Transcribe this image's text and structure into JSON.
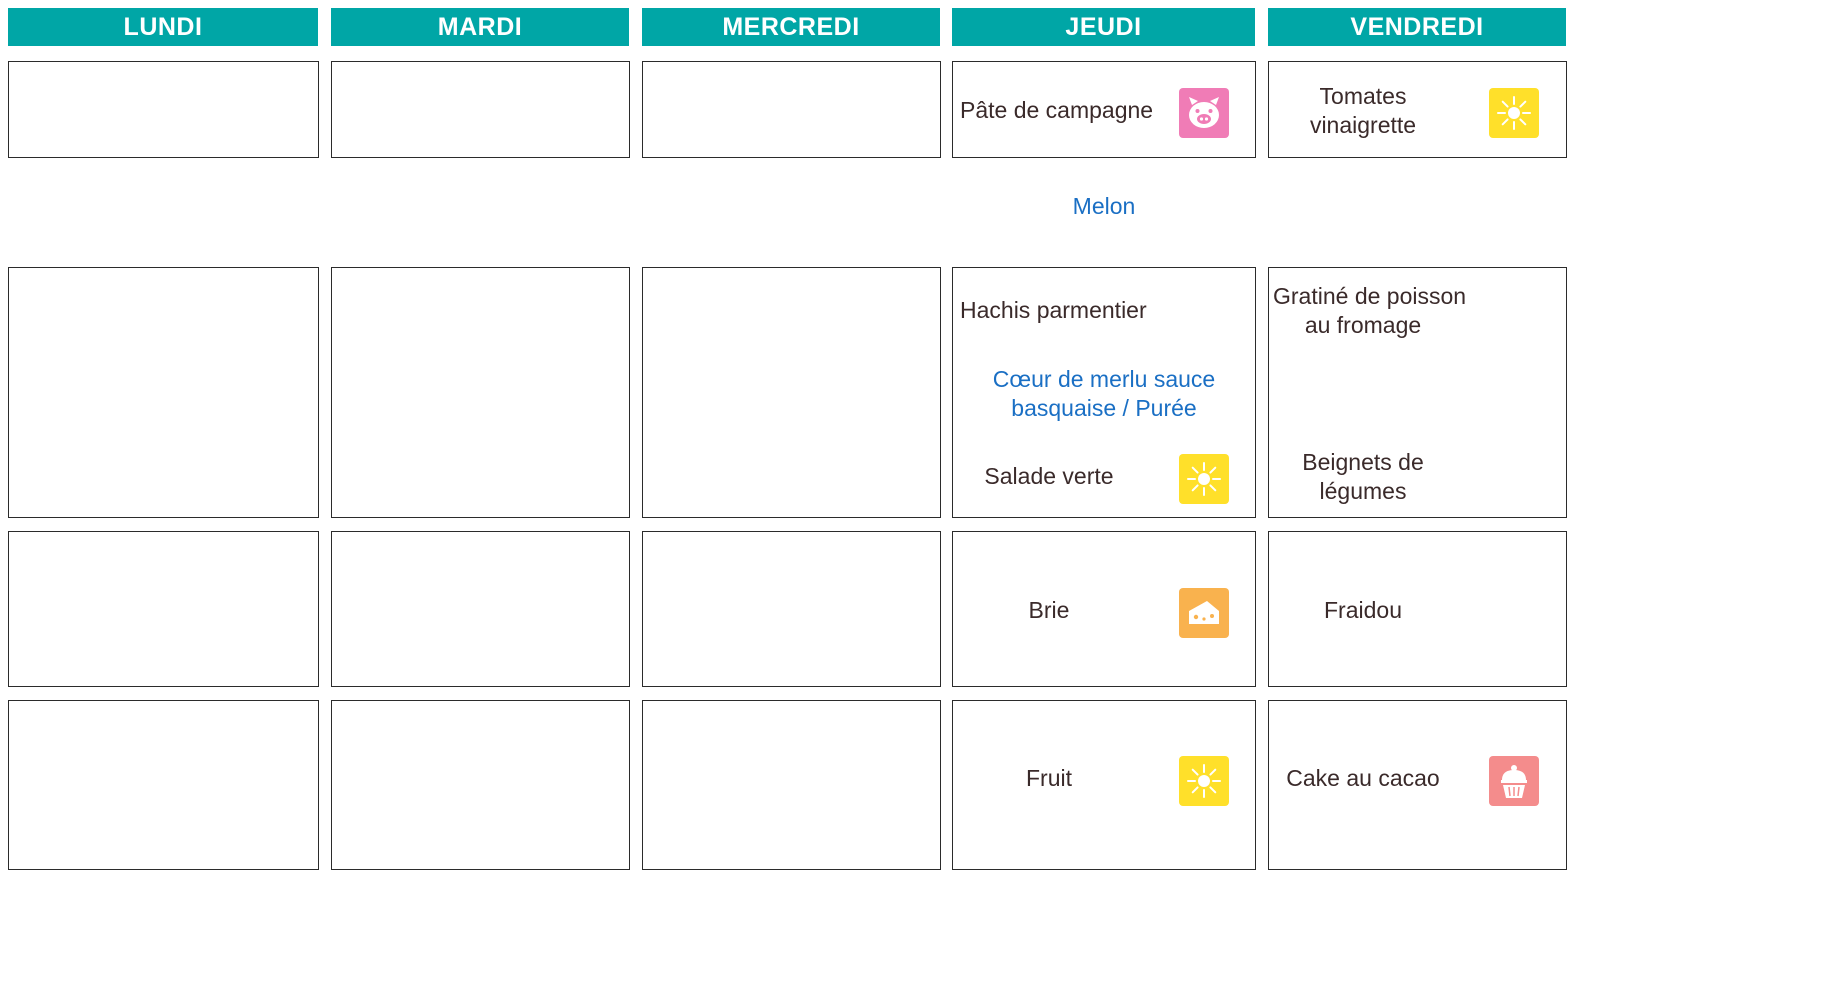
{
  "days": [
    "LUNDI",
    "MARDI",
    "MERCREDI",
    "JEUDI",
    "VENDREDI"
  ],
  "menu": {
    "jeudi": {
      "entree": "Pâte de campagne",
      "entree_alt": "Melon",
      "plat": "Hachis parmentier",
      "plat_alt_line1": "Cœur de merlu sauce",
      "plat_alt_line2": "basquaise / Purée",
      "accompagnement": "Salade verte",
      "fromage": "Brie",
      "dessert": "Fruit"
    },
    "vendredi": {
      "entree_line1": "Tomates",
      "entree_line2": "vinaigrette",
      "plat_line1": "Gratiné de poisson",
      "plat_line2": "au fromage",
      "accompagnement_line1": "Beignets de",
      "accompagnement_line2": "légumes",
      "fromage": "Fraidou",
      "dessert": "Cake au cacao"
    }
  },
  "icons": {
    "pig": {
      "name": "pig-icon",
      "color": "#f07cb6"
    },
    "sun": {
      "name": "sun-icon",
      "color": "#ffe02a"
    },
    "cheese": {
      "name": "cheese-icon",
      "color": "#f9b24e"
    },
    "cupcake": {
      "name": "cupcake-icon",
      "color": "#f48c8c"
    }
  },
  "colors": {
    "header_bg": "#00a6a6",
    "text": "#3a2a2a",
    "alt_text": "#1a6fc4"
  }
}
